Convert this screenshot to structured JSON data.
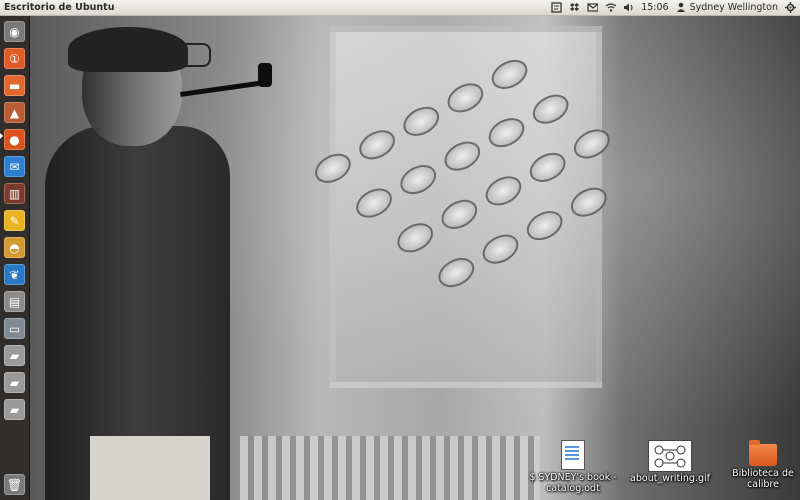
{
  "topbar": {
    "title": "Escritorio de Ubuntu",
    "tray": {
      "icons": [
        "notes-icon",
        "dropbox-icon",
        "mail-icon",
        "wifi-icon",
        "volume-icon"
      ],
      "time": "15:06",
      "user": "Sydney Wellington"
    }
  },
  "launcher": {
    "items": [
      {
        "name": "dash-home",
        "icon": "ubuntu-logo-icon",
        "color": "#7a7a7a"
      },
      {
        "name": "ubuntu-one",
        "icon": "ubuntu-one-icon",
        "color": "#e05a26"
      },
      {
        "name": "files",
        "icon": "folder-icon",
        "color": "#e3682f"
      },
      {
        "name": "software-center",
        "icon": "software-center-icon",
        "color": "#b85c35"
      },
      {
        "name": "firefox",
        "icon": "firefox-icon",
        "color": "#d9531e"
      },
      {
        "name": "thunderbird",
        "icon": "thunderbird-icon",
        "color": "#2d7fd3"
      },
      {
        "name": "calibre",
        "icon": "books-icon",
        "color": "#7b3b2a"
      },
      {
        "name": "text-editor",
        "icon": "pencil-icon",
        "color": "#e8b421"
      },
      {
        "name": "cake-app",
        "icon": "cake-icon",
        "color": "#d49a32"
      },
      {
        "name": "wing-app",
        "icon": "wing-icon",
        "color": "#2a78c2"
      },
      {
        "name": "scanner",
        "icon": "scanner-icon",
        "color": "#8a8a8a"
      },
      {
        "name": "display",
        "icon": "monitor-icon",
        "color": "#7f8a94"
      },
      {
        "name": "usb-drive-1",
        "icon": "drive-icon",
        "color": "#9a9a9a"
      },
      {
        "name": "usb-drive-2",
        "icon": "drive-icon",
        "color": "#9a9a9a"
      },
      {
        "name": "usb-drive-3",
        "icon": "drive-icon",
        "color": "#9a9a9a"
      },
      {
        "name": "trash",
        "icon": "trash-icon",
        "color": "#7a7a7a"
      }
    ]
  },
  "desktop": {
    "icons": [
      {
        "label": "$ SYDNEY's book -\ncatalog.odt",
        "icon": "document-icon"
      },
      {
        "label": "about_writing.gif",
        "icon": "image-icon"
      },
      {
        "label": "Biblioteca de\ncalibre",
        "icon": "folder-icon"
      }
    ]
  }
}
